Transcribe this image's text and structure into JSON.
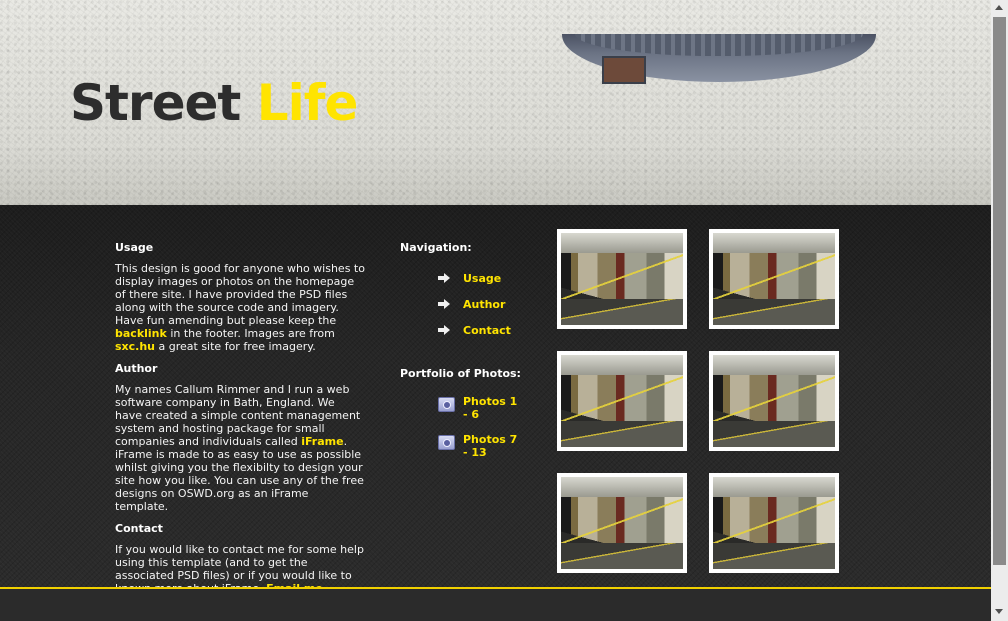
{
  "header": {
    "logo_part1": "Street",
    "logo_part2": "Life"
  },
  "usage": {
    "heading": "Usage",
    "text_before_backlink": "This design is good for anyone who wishes to display images or photos on the homepage of there site. I have provided the PSD files along with the source code and imagery. Have fun amending but please keep the ",
    "backlink": "backlink",
    "text_mid": " in the footer. Images are from ",
    "sxc_link": "sxc.hu",
    "text_after": " a great site for free imagery."
  },
  "author": {
    "heading": "Author",
    "text_before_link": "My names Callum Rimmer and I run a web software company in Bath, England. We have created a simple content management system and hosting package for small companies and individuals called ",
    "iframe_link": "iFrame",
    "text_after": ". iFrame is made to as easy to use as possible whilst giving you the flexibilty to design your site how you like. You can use any of the free designs on OSWD.org as an iFrame template."
  },
  "contact": {
    "heading": "Contact",
    "text_before_link": "If you would like to contact me for some help using this template (and to get the associated PSD files) or if you would like to known more about iFrame, ",
    "email_link": "Email me",
    "text_after": "."
  },
  "navigation": {
    "heading": "Navigation:",
    "items": [
      {
        "label": "Usage",
        "icon": "arrow-right-icon"
      },
      {
        "label": "Author",
        "icon": "arrow-right-icon"
      },
      {
        "label": "Contact",
        "icon": "arrow-right-icon"
      }
    ]
  },
  "portfolio": {
    "heading": "Portfolio of Photos:",
    "items": [
      {
        "label": "Photos 1 - 6",
        "icon": "camera-icon"
      },
      {
        "label": "Photos 7 - 13",
        "icon": "camera-icon"
      }
    ]
  },
  "colors": {
    "accent": "#ffe400",
    "background_dark": "#2a2a2a",
    "text_light": "#f4f4f4"
  }
}
